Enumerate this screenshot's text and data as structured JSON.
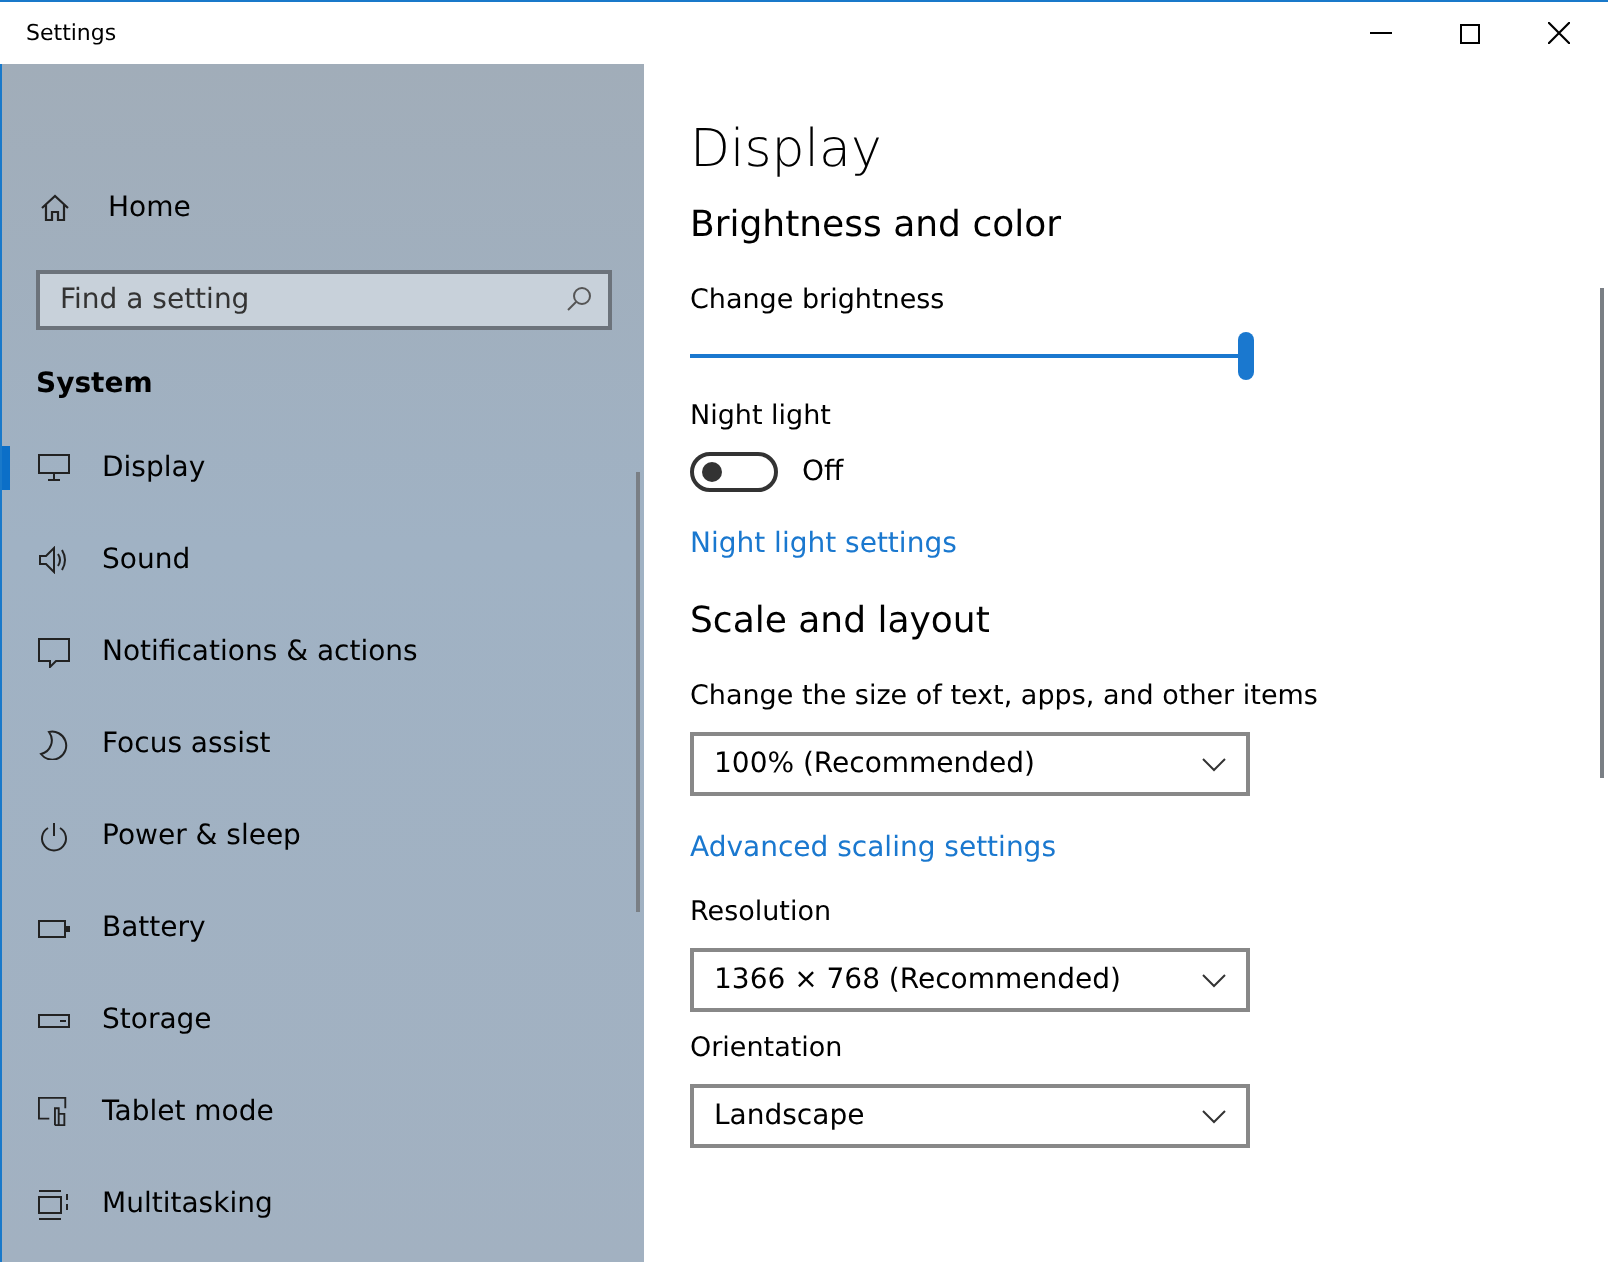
{
  "window": {
    "title": "Settings"
  },
  "sidebar": {
    "home": "Home",
    "search": {
      "placeholder": "Find a setting"
    },
    "section": "System",
    "items": [
      {
        "label": "Display",
        "selected": true
      },
      {
        "label": "Sound",
        "selected": false
      },
      {
        "label": "Notifications & actions",
        "selected": false
      },
      {
        "label": "Focus assist",
        "selected": false
      },
      {
        "label": "Power & sleep",
        "selected": false
      },
      {
        "label": "Battery",
        "selected": false
      },
      {
        "label": "Storage",
        "selected": false
      },
      {
        "label": "Tablet mode",
        "selected": false
      },
      {
        "label": "Multitasking",
        "selected": false
      }
    ]
  },
  "page": {
    "title": "Display",
    "brightness": {
      "heading": "Brightness and color",
      "label": "Change brightness",
      "level": 1.0
    },
    "night_light": {
      "label": "Night light",
      "on": false,
      "state_text": "Off",
      "link": "Night light settings"
    },
    "scale": {
      "heading": "Scale and layout",
      "size_label": "Change the size of text, apps, and other items",
      "size_value": "100% (Recommended)",
      "link": "Advanced scaling settings",
      "resolution_label": "Resolution",
      "resolution_value": "1366 × 768 (Recommended)",
      "orientation_label": "Orientation",
      "orientation_value": "Landscape"
    }
  }
}
